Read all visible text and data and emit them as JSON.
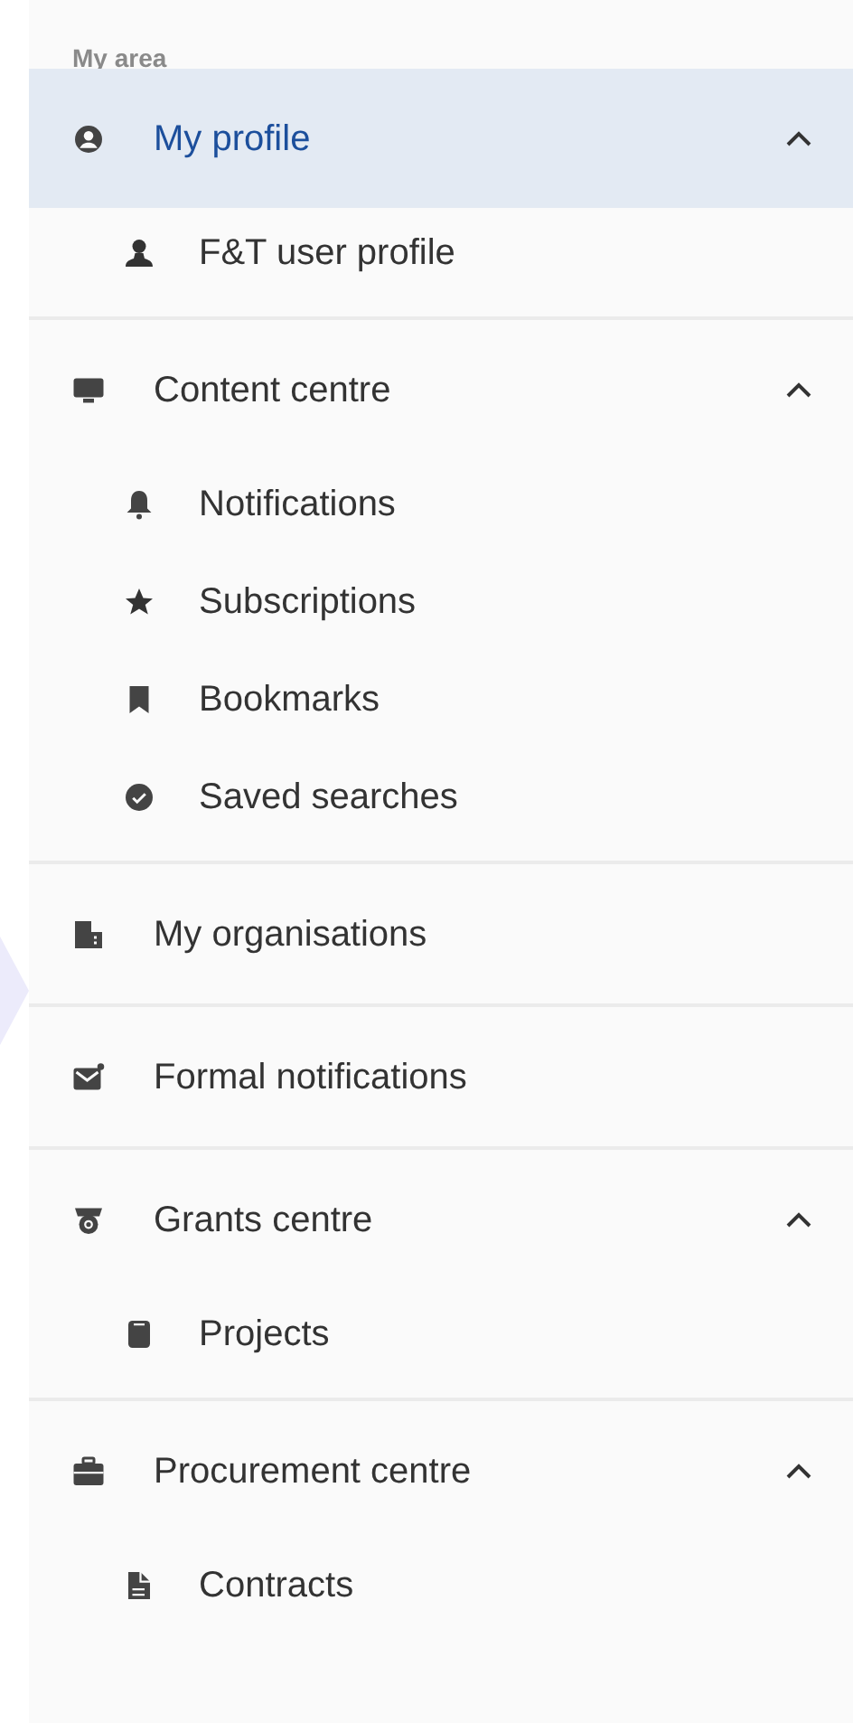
{
  "heading": "My area",
  "sections": [
    {
      "label": "My profile",
      "selected": true,
      "expanded": true,
      "children": [
        {
          "label": "F&T user profile"
        }
      ]
    },
    {
      "label": "Content centre",
      "selected": false,
      "expanded": true,
      "children": [
        {
          "label": "Notifications"
        },
        {
          "label": "Subscriptions"
        },
        {
          "label": "Bookmarks"
        },
        {
          "label": "Saved searches"
        }
      ]
    },
    {
      "label": "My organisations",
      "selected": false
    },
    {
      "label": "Formal notifications",
      "selected": false
    },
    {
      "label": "Grants centre",
      "selected": false,
      "expanded": true,
      "children": [
        {
          "label": "Projects"
        }
      ]
    },
    {
      "label": "Procurement centre",
      "selected": false,
      "expanded": true,
      "children": [
        {
          "label": "Contracts"
        }
      ]
    }
  ]
}
